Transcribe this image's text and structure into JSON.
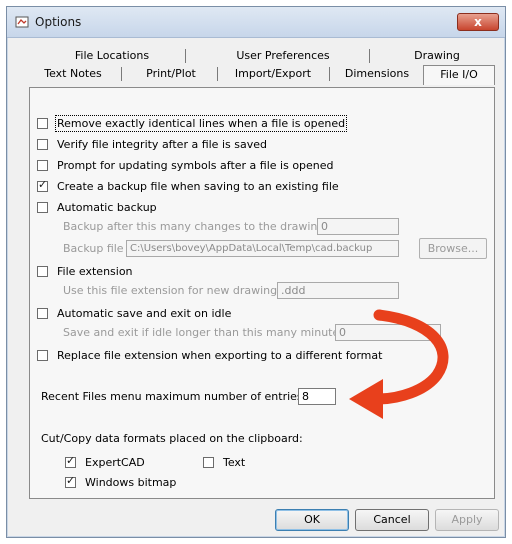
{
  "window": {
    "title": "Options",
    "close_label": "x"
  },
  "tabs_row1": [
    {
      "label": "File Locations"
    },
    {
      "label": "User Preferences"
    },
    {
      "label": "Drawing"
    }
  ],
  "tabs_row2": [
    {
      "label": "Text Notes"
    },
    {
      "label": "Print/Plot"
    },
    {
      "label": "Import/Export"
    },
    {
      "label": "Dimensions"
    },
    {
      "label": "File I/O",
      "active": true
    }
  ],
  "options": {
    "remove_duplicates": {
      "label": "Remove exactly identical lines when a file is opened",
      "checked": false
    },
    "verify_integrity": {
      "label": "Verify file integrity after a file is saved",
      "checked": false
    },
    "prompt_symbols": {
      "label": "Prompt for updating symbols after a file is opened",
      "checked": false
    },
    "create_backup": {
      "label": "Create a backup file when saving to an existing file",
      "checked": true
    },
    "automatic_backup": {
      "label": "Automatic backup",
      "checked": false
    },
    "backup_after_label": "Backup after this many changes to the drawing",
    "backup_after_value": "0",
    "backup_file_label": "Backup file",
    "backup_file_value": "C:\\Users\\bovey\\AppData\\Local\\Temp\\cad.backup",
    "browse_label": "Browse...",
    "file_extension": {
      "label": "File extension",
      "checked": false
    },
    "extension_label": "Use this file extension for new drawings:",
    "extension_value": ".ddd",
    "auto_save_exit": {
      "label": "Automatic save and exit on idle",
      "checked": false
    },
    "idle_label": "Save and exit if idle longer than this many minutes:",
    "idle_value": "0",
    "replace_extension": {
      "label": "Replace file extension when exporting to a different format",
      "checked": false
    },
    "recent_files_label": "Recent Files menu maximum number of entries:",
    "recent_files_value": "8",
    "clipboard_heading": "Cut/Copy data formats placed on the clipboard:",
    "expertcad": {
      "label": "ExpertCAD",
      "checked": true
    },
    "text": {
      "label": "Text",
      "checked": false
    },
    "windows_bitmap": {
      "label": "Windows bitmap",
      "checked": true
    }
  },
  "buttons": {
    "ok": "OK",
    "cancel": "Cancel",
    "apply": "Apply"
  },
  "annotation": {
    "arrow_color": "#e8401c"
  }
}
